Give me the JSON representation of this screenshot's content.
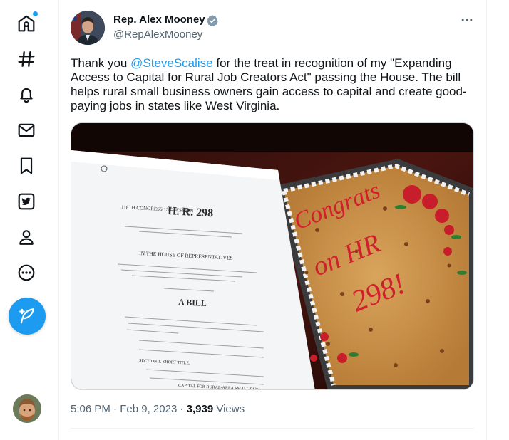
{
  "nav": {
    "items": [
      {
        "icon": "home-icon"
      },
      {
        "icon": "explore-hashtag-icon"
      },
      {
        "icon": "notifications-bell-icon"
      },
      {
        "icon": "messages-mail-icon"
      },
      {
        "icon": "bookmarks-icon"
      },
      {
        "icon": "twitter-blue-icon"
      },
      {
        "icon": "profile-icon"
      },
      {
        "icon": "more-circle-icon"
      }
    ],
    "compose_icon": "compose-feather-icon",
    "accent": "#1d9bf0"
  },
  "tweet": {
    "author_name": "Rep. Alex Mooney",
    "handle": "@RepAlexMooney",
    "verified_color": "#829aab",
    "text_before": "Thank you ",
    "mention": "@SteveScalise",
    "text_after": " for the treat in recognition of my \"Expanding Access to Capital for Rural Job Creators Act\" passing the House. The bill helps rural small business owners gain access to capital and create good-paying jobs in states like West Virginia.",
    "time": "5:06 PM",
    "date": "Feb 9, 2023",
    "views_count": "3,939",
    "views_label": "Views"
  },
  "media": {
    "doc_congress": "118TH CONGRESS 1ST SESSION",
    "doc_number": "H. R. 298",
    "doc_house": "IN THE HOUSE OF REPRESENTATIVES",
    "doc_bill": "A BILL",
    "doc_section": "SECTION 1. SHORT TITLE.",
    "doc_section2": "CAPITAL FOR RURAL-AREA SMALL BUSI",
    "cake_line1": "Congrats",
    "cake_line2": "on HR",
    "cake_line3": "298!"
  }
}
